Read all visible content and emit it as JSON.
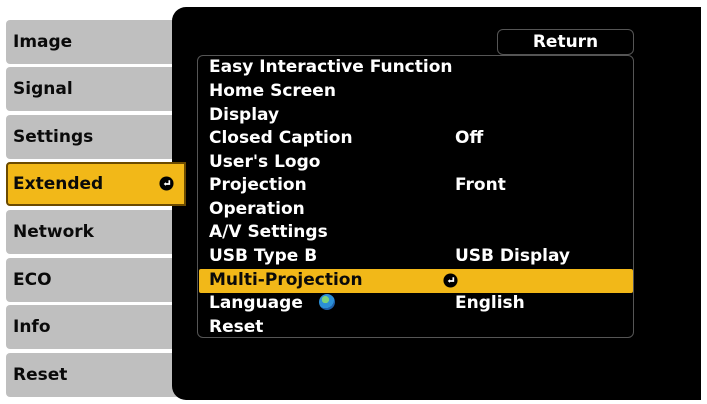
{
  "sidebar": {
    "items": [
      {
        "label": "Image"
      },
      {
        "label": "Signal"
      },
      {
        "label": "Settings"
      },
      {
        "label": "Extended"
      },
      {
        "label": "Network"
      },
      {
        "label": "ECO"
      },
      {
        "label": "Info"
      },
      {
        "label": "Reset"
      }
    ],
    "active_index": 3
  },
  "panel": {
    "return_label": "Return",
    "menu": [
      {
        "label": "Easy Interactive Function",
        "value": ""
      },
      {
        "label": "Home Screen",
        "value": ""
      },
      {
        "label": "Display",
        "value": ""
      },
      {
        "label": "Closed Caption",
        "value": "Off"
      },
      {
        "label": "User's Logo",
        "value": ""
      },
      {
        "label": "Projection",
        "value": "Front"
      },
      {
        "label": "Operation",
        "value": ""
      },
      {
        "label": "A/V Settings",
        "value": ""
      },
      {
        "label": "USB Type B",
        "value": "USB Display"
      },
      {
        "label": "Multi-Projection",
        "value": ""
      },
      {
        "label": "Language",
        "value": "English"
      },
      {
        "label": "Reset",
        "value": ""
      }
    ],
    "selected_index": 9
  },
  "colors": {
    "highlight": "#f2b818",
    "tab": "#bfbfbf",
    "panel": "#000000"
  },
  "icons": {
    "enter": "enter-icon",
    "language": "globe-icon"
  }
}
